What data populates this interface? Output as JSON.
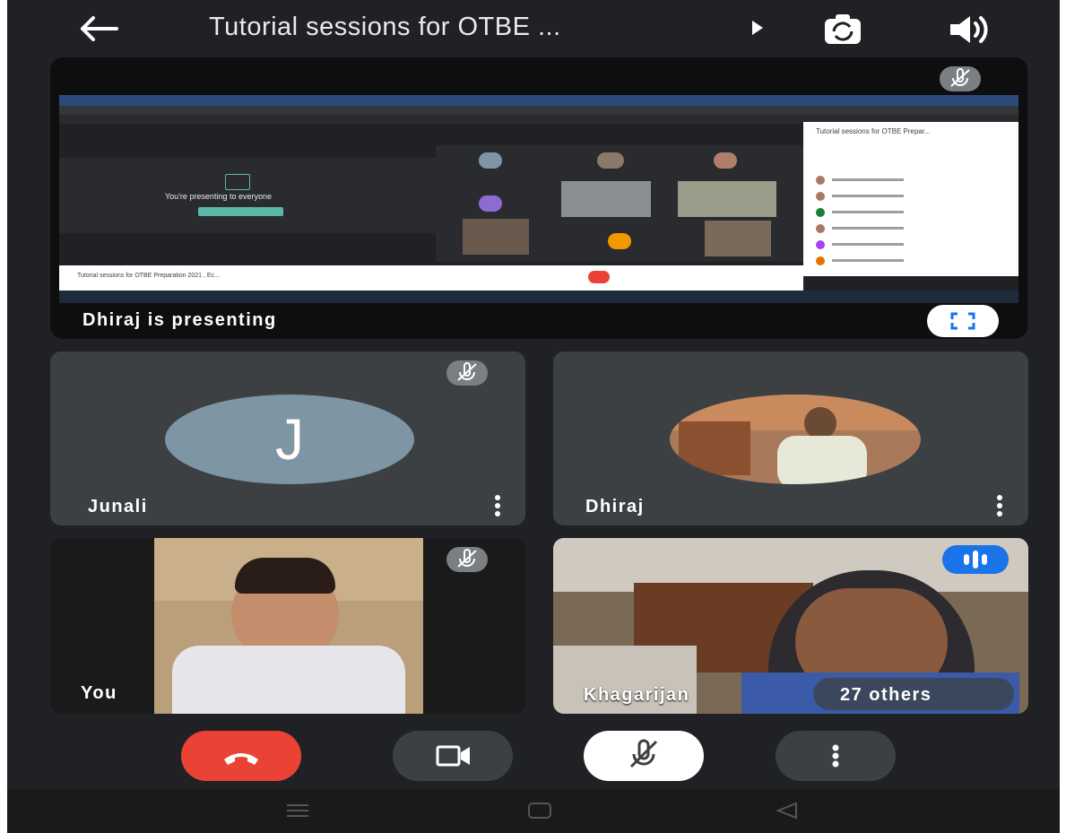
{
  "header": {
    "title": "Tutorial sessions for OTBE ...",
    "back_icon": "arrow-left-icon",
    "play_icon": "play-icon",
    "camera_switch_icon": "camera-switch-icon",
    "speaker_icon": "speaker-icon"
  },
  "presentation": {
    "caption": "Dhiraj is presenting",
    "mute_icon": "mic-off-icon",
    "fullscreen_icon": "fullscreen-icon",
    "inner": {
      "presenting_text": "You're presenting to everyone",
      "sidebar_title": "Tutorial sessions for OTBE Prepar...",
      "bottom_title": "Tutorial sessions for OTBE Preparation 2021 , Ec..."
    }
  },
  "tiles": [
    {
      "id": "junali",
      "name": "Junali",
      "avatar_letter": "J",
      "muted": true
    },
    {
      "id": "dhiraj",
      "name": "Dhiraj",
      "muted": false
    },
    {
      "id": "you",
      "name": "You",
      "muted": true
    },
    {
      "id": "khagarijan",
      "name": "Khagarijan",
      "others": "27 others",
      "speaking": true
    }
  ],
  "controls": {
    "end_call_icon": "end-call-icon",
    "camera_icon": "camera-icon",
    "mic_icon": "mic-off-icon",
    "more_icon": "more-vertical-icon"
  },
  "navbar": {
    "menu_icon": "recent-apps-icon",
    "home_icon": "home-icon",
    "back_icon": "back-triangle-icon"
  },
  "colors": {
    "background": "#202124",
    "tile": "#3c4043",
    "end_call": "#ea4335",
    "avatar_j": "#7e95a4",
    "speaking_badge": "#1a73e8"
  }
}
